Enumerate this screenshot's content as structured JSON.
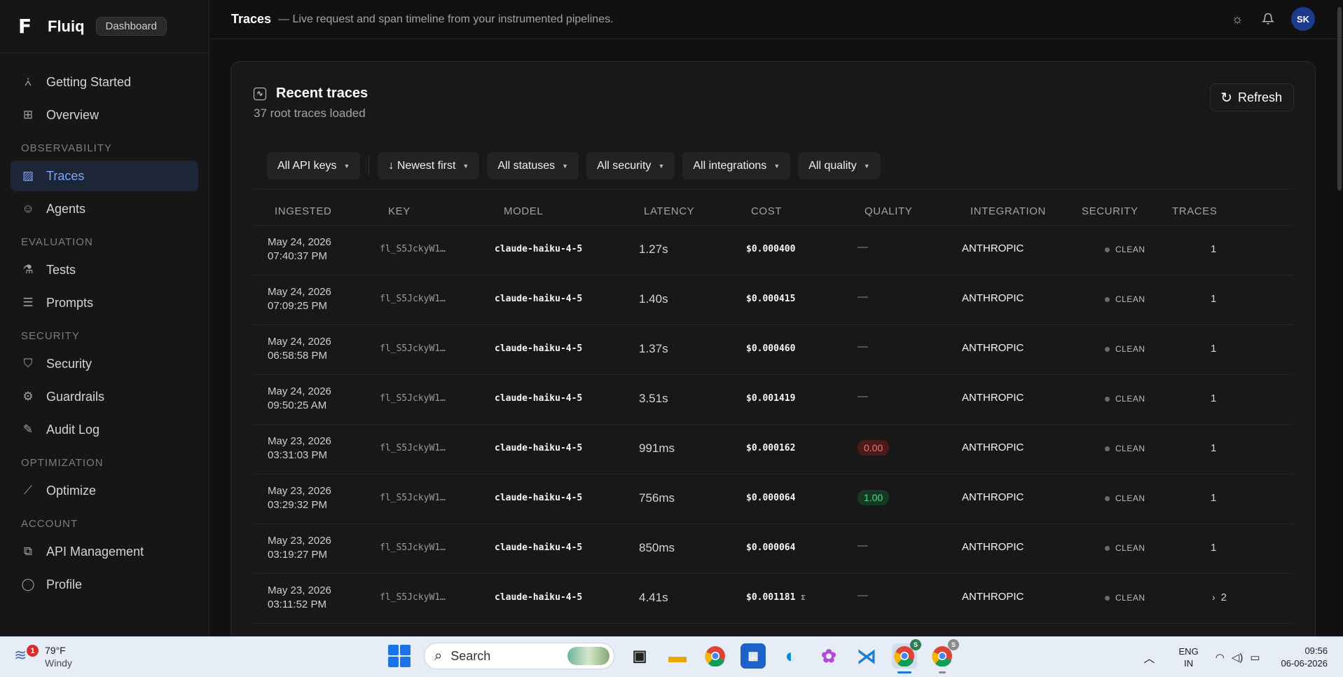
{
  "brand": {
    "name": "Fluiq",
    "badge": "Dashboard",
    "logo": "F"
  },
  "sidebar": {
    "items": [
      {
        "label": "Getting Started",
        "icon": "rocket-icon"
      },
      {
        "label": "Overview",
        "icon": "grid-icon"
      },
      {
        "section": "OBSERVABILITY"
      },
      {
        "label": "Traces",
        "icon": "trace-icon",
        "active": true
      },
      {
        "label": "Agents",
        "icon": "bot-icon"
      },
      {
        "section": "EVALUATION"
      },
      {
        "label": "Tests",
        "icon": "flask-icon"
      },
      {
        "label": "Prompts",
        "icon": "prompt-icon"
      },
      {
        "section": "SECURITY"
      },
      {
        "label": "Security",
        "icon": "shield-icon"
      },
      {
        "label": "Guardrails",
        "icon": "gear-icon"
      },
      {
        "label": "Audit Log",
        "icon": "log-icon"
      },
      {
        "section": "OPTIMIZATION"
      },
      {
        "label": "Optimize",
        "icon": "wand-icon"
      },
      {
        "section": "ACCOUNT"
      },
      {
        "label": "API Management",
        "icon": "api-icon"
      },
      {
        "label": "Profile",
        "icon": "user-icon"
      }
    ]
  },
  "header": {
    "title": "Traces",
    "subtitle": "— Live request and span timeline from your instrumented pipelines.",
    "avatar": "SK"
  },
  "card": {
    "title": "Recent traces",
    "subtitle": "37 root traces loaded",
    "refresh_label": "Refresh"
  },
  "filters": [
    "All API keys",
    "↓ Newest first",
    "All statuses",
    "All security",
    "All integrations",
    "All quality"
  ],
  "table": {
    "columns": [
      "INGESTED",
      "KEY",
      "MODEL",
      "LATENCY",
      "COST",
      "QUALITY",
      "INTEGRATION",
      "SECURITY",
      "TRACES"
    ],
    "rows": [
      {
        "date": "May 24, 2026",
        "time": "07:40:37 PM",
        "key": "fl_S5JckyW1…",
        "model": "claude-haiku-4-5",
        "latency": "1.27s",
        "cost": "$0.000400",
        "quality": "—",
        "quality_kind": "none",
        "integration": "ANTHROPIC",
        "security": "CLEAN",
        "traces": "1"
      },
      {
        "date": "May 24, 2026",
        "time": "07:09:25 PM",
        "key": "fl_S5JckyW1…",
        "model": "claude-haiku-4-5",
        "latency": "1.40s",
        "cost": "$0.000415",
        "quality": "—",
        "quality_kind": "none",
        "integration": "ANTHROPIC",
        "security": "CLEAN",
        "traces": "1"
      },
      {
        "date": "May 24, 2026",
        "time": "06:58:58 PM",
        "key": "fl_S5JckyW1…",
        "model": "claude-haiku-4-5",
        "latency": "1.37s",
        "cost": "$0.000460",
        "quality": "—",
        "quality_kind": "none",
        "integration": "ANTHROPIC",
        "security": "CLEAN",
        "traces": "1"
      },
      {
        "date": "May 24, 2026",
        "time": "09:50:25 AM",
        "key": "fl_S5JckyW1…",
        "model": "claude-haiku-4-5",
        "latency": "3.51s",
        "cost": "$0.001419",
        "quality": "—",
        "quality_kind": "none",
        "integration": "ANTHROPIC",
        "security": "CLEAN",
        "traces": "1"
      },
      {
        "date": "May 23, 2026",
        "time": "03:31:03 PM",
        "key": "fl_S5JckyW1…",
        "model": "claude-haiku-4-5",
        "latency": "991ms",
        "cost": "$0.000162",
        "quality": "0.00",
        "quality_kind": "red",
        "integration": "ANTHROPIC",
        "security": "CLEAN",
        "traces": "1"
      },
      {
        "date": "May 23, 2026",
        "time": "03:29:32 PM",
        "key": "fl_S5JckyW1…",
        "model": "claude-haiku-4-5",
        "latency": "756ms",
        "cost": "$0.000064",
        "quality": "1.00",
        "quality_kind": "green",
        "integration": "ANTHROPIC",
        "security": "CLEAN",
        "traces": "1"
      },
      {
        "date": "May 23, 2026",
        "time": "03:19:27 PM",
        "key": "fl_S5JckyW1…",
        "model": "claude-haiku-4-5",
        "latency": "850ms",
        "cost": "$0.000064",
        "quality": "—",
        "quality_kind": "none",
        "integration": "ANTHROPIC",
        "security": "CLEAN",
        "traces": "1"
      },
      {
        "date": "May 23, 2026",
        "time": "03:11:52 PM",
        "key": "fl_S5JckyW1…",
        "model": "claude-haiku-4-5",
        "latency": "4.41s",
        "cost": "$0.001181",
        "cost_marker": "Σ",
        "quality": "—",
        "quality_kind": "none",
        "integration": "ANTHROPIC",
        "security": "CLEAN",
        "traces": "2",
        "expandable": true
      }
    ]
  },
  "taskbar": {
    "weather_badge": "1",
    "temp": "79°F",
    "condition": "Windy",
    "search_placeholder": "Search",
    "lang": "ENG",
    "region": "IN",
    "time": "09:56",
    "date": "06-06-2026"
  },
  "colors": {
    "accent": "#7aa5ff",
    "active_bg": "#1c2636",
    "avatar": "#1e3a8a"
  }
}
